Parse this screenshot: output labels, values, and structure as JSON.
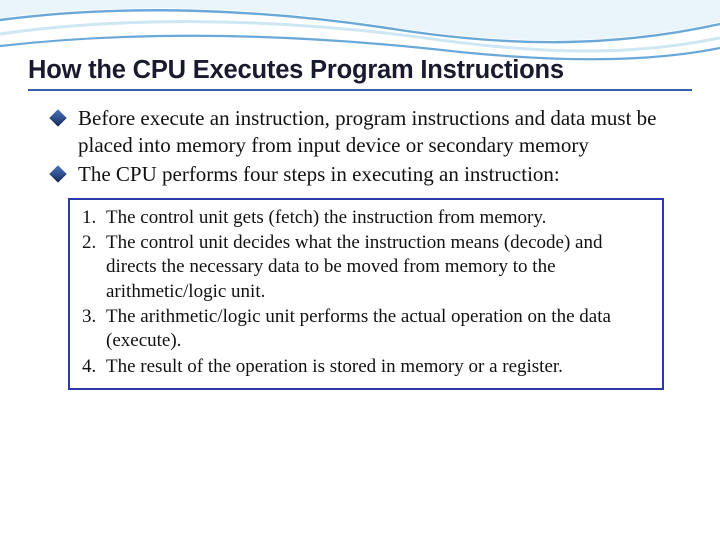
{
  "title": "How the CPU Executes Program Instructions",
  "bullets": [
    "Before execute an instruction, program instructions and data must be placed into memory from input device or secondary memory",
    "The CPU performs four steps in executing an instruction:"
  ],
  "steps": [
    "The control unit gets (fetch) the instruction from memory.",
    "The control unit decides what the instruction means (decode) and directs the necessary data to be moved from memory to the arithmetic/logic unit.",
    "The arithmetic/logic unit performs the actual operation on the data (execute).",
    "The result of the operation is stored in memory or a register."
  ],
  "colors": {
    "title_underline": "#3860a8",
    "box_border": "#2a3aa8",
    "bullet_fill": "#2a4a88"
  }
}
